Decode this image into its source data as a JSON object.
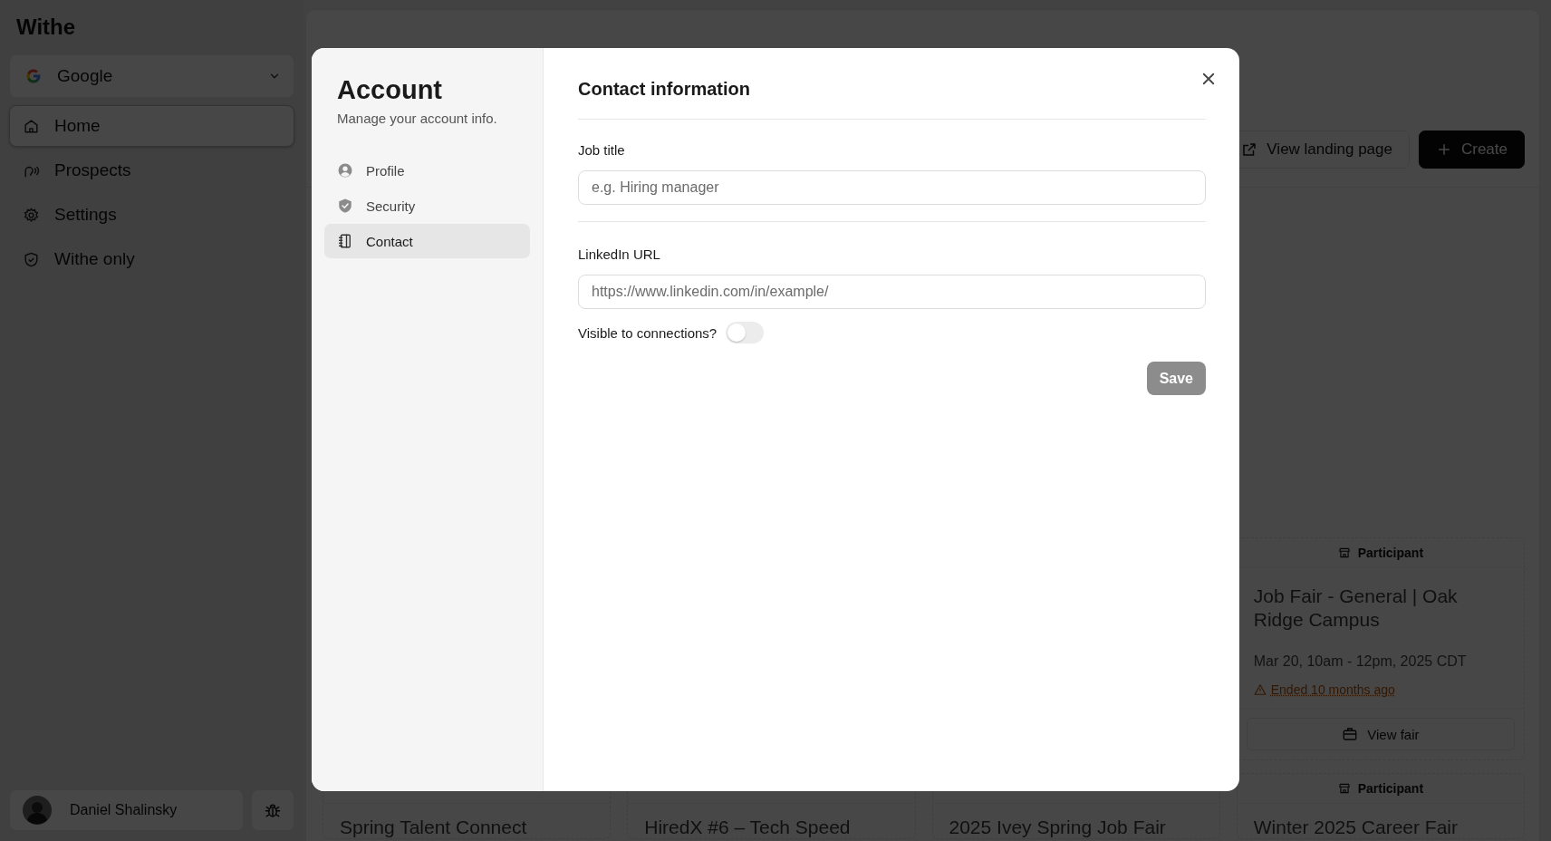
{
  "app_name": "Withe",
  "org_selector": {
    "label": "Google"
  },
  "sidebar": {
    "items": [
      {
        "label": "Home",
        "selected": true
      },
      {
        "label": "Prospects",
        "selected": false
      },
      {
        "label": "Settings",
        "selected": false
      },
      {
        "label": "Withe only",
        "selected": false
      }
    ]
  },
  "user": {
    "name": "Daniel Shalinsky"
  },
  "header_buttons": [
    {
      "label": "View landing page",
      "kind": "outline"
    },
    {
      "label": "Create",
      "kind": "primary"
    }
  ],
  "cards": [
    {
      "header": "Participant",
      "title": "Job Fair - General | Oak Ridge Campus",
      "date": "Mar 20, 10am - 12pm, 2025 CDT",
      "status": "Ended 10 months ago",
      "button": "View fair"
    }
  ],
  "bottom_cards": [
    {
      "title": "Spring Talent Connect"
    },
    {
      "title": "HiredX #6 – Tech Speed"
    },
    {
      "title": "2025 Ivey Spring Job Fair"
    },
    {
      "header": "Participant",
      "title": "Winter 2025 Career Fair"
    }
  ],
  "modal": {
    "title": "Account",
    "subtitle": "Manage your account info.",
    "nav": [
      {
        "label": "Profile",
        "selected": false
      },
      {
        "label": "Security",
        "selected": false
      },
      {
        "label": "Contact",
        "selected": true
      }
    ],
    "section_title": "Contact information",
    "fields": [
      {
        "label": "Job title",
        "placeholder": "e.g. Hiring manager"
      },
      {
        "label": "LinkedIn URL",
        "placeholder": "https://www.linkedin.com/in/example/"
      }
    ],
    "toggle": {
      "label": "Visible to connections?",
      "on": false
    },
    "save": {
      "label": "Save",
      "disabled": true
    }
  }
}
